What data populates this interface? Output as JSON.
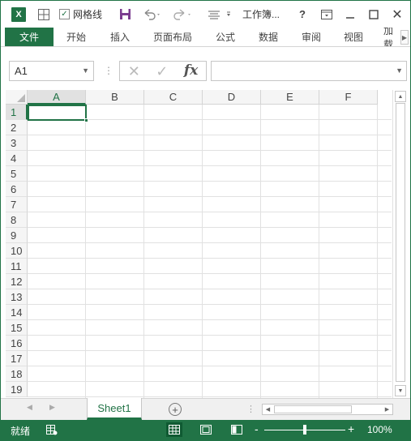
{
  "titlebar": {
    "app_icon": "excel-logo-icon",
    "app_icon_letter": "X",
    "gridlines_label": "网格线",
    "gridlines_checked": "✓",
    "title": "工作簿...",
    "help": "?",
    "close": "✕"
  },
  "ribbon": {
    "tabs": [
      {
        "label": "文件"
      },
      {
        "label": "开始"
      },
      {
        "label": "插入"
      },
      {
        "label": "页面布局"
      },
      {
        "label": "公式"
      },
      {
        "label": "数据"
      },
      {
        "label": "审阅"
      },
      {
        "label": "视图"
      },
      {
        "label": "加载"
      }
    ]
  },
  "formula_bar": {
    "name_box": "A1",
    "cancel_glyph": "✕",
    "enter_glyph": "✓",
    "fx": "fx",
    "formula_value": ""
  },
  "grid": {
    "columns": [
      "A",
      "B",
      "C",
      "D",
      "E",
      "F"
    ],
    "rows": [
      "1",
      "2",
      "3",
      "4",
      "5",
      "6",
      "7",
      "8",
      "9",
      "10",
      "11",
      "12",
      "13",
      "14",
      "15",
      "16",
      "17",
      "18",
      "19"
    ],
    "selected_cell": "A1"
  },
  "sheets": {
    "tabs": [
      {
        "label": "Sheet1",
        "active": true
      }
    ],
    "add_glyph": "+"
  },
  "status_bar": {
    "ready": "就绪",
    "zoom_minus": "-",
    "zoom_plus": "+",
    "zoom_level": "100%",
    "zoom_fraction": 0.5
  },
  "colors": {
    "accent": "#217346"
  }
}
